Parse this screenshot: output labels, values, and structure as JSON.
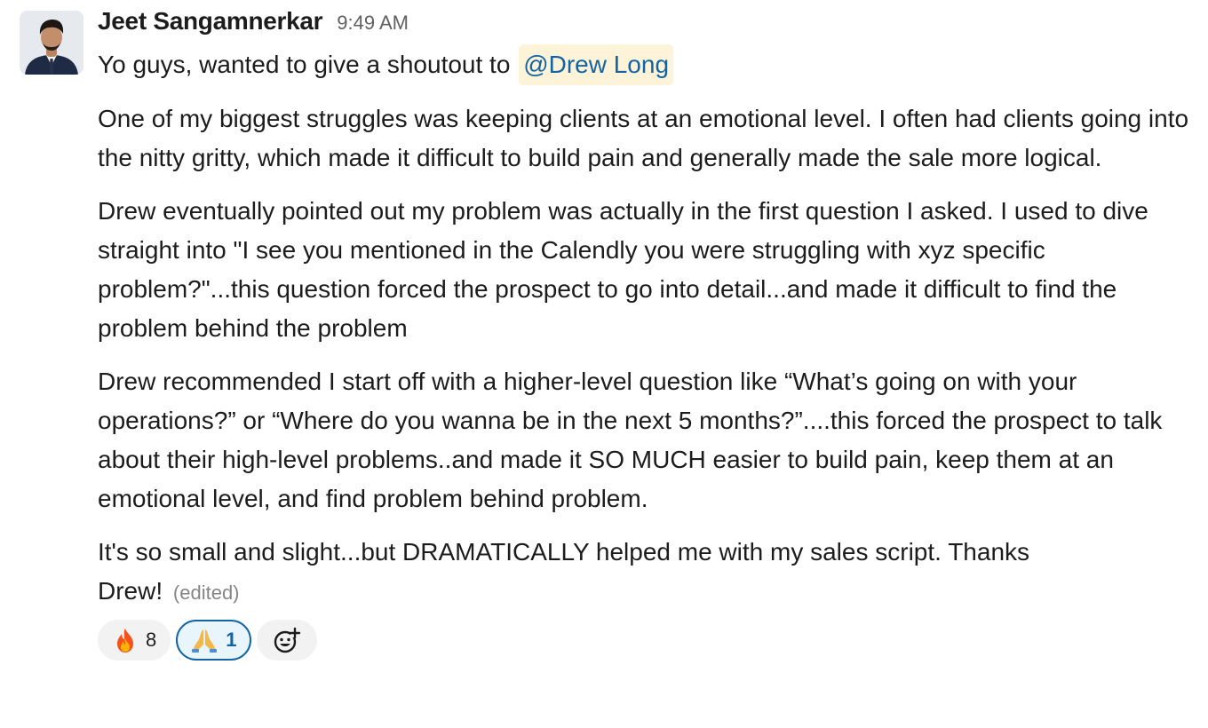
{
  "message": {
    "author": "Jeet Sangamnerkar",
    "time": "9:49 AM",
    "intro": "Yo guys, wanted to give a shoutout to ",
    "mention": "@Drew Long",
    "paragraphs": [
      "One of my biggest struggles was keeping clients at an emotional level. I often had clients going into the nitty gritty, which made it difficult to build pain and generally made the sale more logical.",
      "Drew eventually pointed out my problem was actually in the first question I asked. I used to dive straight into \"I see you mentioned in the Calendly you were struggling with xyz specific problem?\"...this question forced the prospect to go into detail...and made it difficult to find the problem behind the problem",
      "Drew recommended I start off with a higher-level question like “What’s going on with your operations?” or “Where do you wanna be in the next 5 months?”....this forced the prospect to talk about their high-level problems..and made it SO MUCH easier to build pain, keep them at an emotional level, and find problem behind problem.",
      "It's so small and slight...but DRAMATICALLY helped me with my sales script. Thanks Drew!"
    ],
    "edited": "(edited)"
  },
  "reactions": [
    {
      "icon": "fire-emoji-icon",
      "count": "8",
      "selected": false
    },
    {
      "icon": "folded-hands-emoji-icon",
      "count": "1",
      "selected": true
    }
  ],
  "add_reaction": {
    "icon": "add-reaction-icon"
  },
  "colors": {
    "mention_bg": "#fdf3d8",
    "mention_text": "#1264a3",
    "selected_reaction_border": "#1264a3",
    "selected_reaction_bg": "#e8f5fa"
  }
}
